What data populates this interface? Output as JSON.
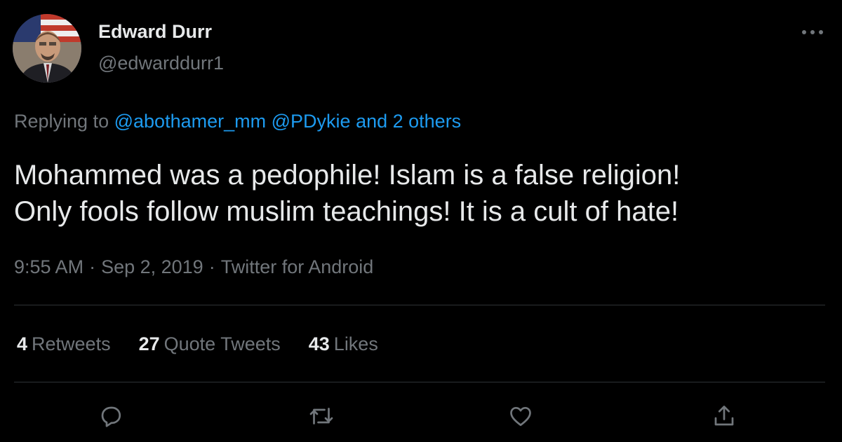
{
  "user": {
    "display_name": "Edward Durr",
    "handle": "@edwarddurr1"
  },
  "reply": {
    "prefix": "Replying to",
    "mention_1": "@abothamer_mm",
    "mention_2": "@PDykie",
    "others": "and 2 others"
  },
  "tweet": {
    "line_1": "Mohammed was a pedophile! Islam is a false religion!",
    "line_2": "Only fools follow muslim teachings! It is a cult of hate!"
  },
  "meta": {
    "time": "9:55 AM",
    "date": "Sep 2, 2019",
    "source": "Twitter for Android",
    "separator": "·"
  },
  "stats": {
    "retweets": {
      "count": "4",
      "label": "Retweets"
    },
    "quote_tweets": {
      "count": "27",
      "label": "Quote Tweets"
    },
    "likes": {
      "count": "43",
      "label": "Likes"
    }
  },
  "icons": {
    "more": "more-options-icon",
    "reply": "reply-icon",
    "retweet": "retweet-icon",
    "like": "heart-icon",
    "share": "share-icon"
  },
  "colors": {
    "background": "#000000",
    "text_primary": "#e7e9ea",
    "text_secondary": "#71767b",
    "accent": "#1d9bf0",
    "divider": "#2f3336"
  }
}
